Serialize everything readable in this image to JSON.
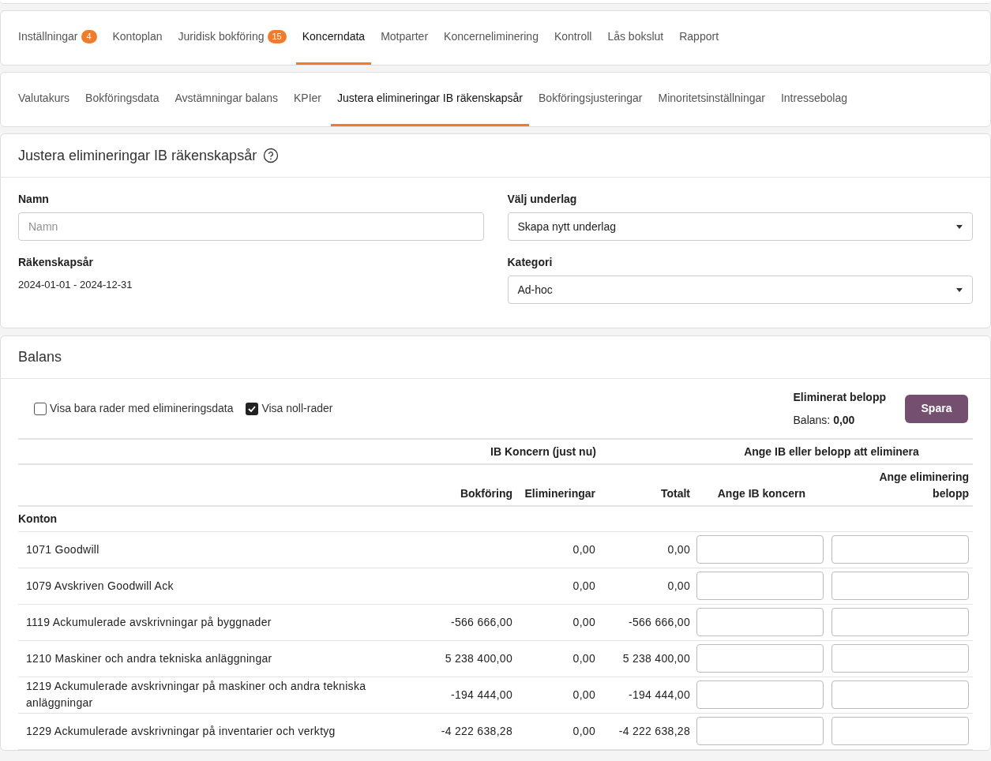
{
  "main_tabs": [
    {
      "label": "Inställningar",
      "badge": "4",
      "selected": false
    },
    {
      "label": "Kontoplan",
      "selected": false
    },
    {
      "label": "Juridisk bokföring",
      "badge": "15",
      "selected": false
    },
    {
      "label": "Koncerndata",
      "selected": true
    },
    {
      "label": "Motparter",
      "selected": false
    },
    {
      "label": "Koncerneliminering",
      "selected": false
    },
    {
      "label": "Kontroll",
      "selected": false
    },
    {
      "label": "Lås bokslut",
      "selected": false
    },
    {
      "label": "Rapport",
      "selected": false
    }
  ],
  "sub_tabs": [
    {
      "label": "Valutakurs",
      "selected": false
    },
    {
      "label": "Bokföringsdata",
      "selected": false
    },
    {
      "label": "Avstämningar balans",
      "selected": false
    },
    {
      "label": "KPIer",
      "selected": false
    },
    {
      "label": "Justera elimineringar IB räkenskapsår",
      "selected": true
    },
    {
      "label": "Bokföringsjusteringar",
      "selected": false
    },
    {
      "label": "Minoritetsinställningar",
      "selected": false
    },
    {
      "label": "Intressebolag",
      "selected": false
    }
  ],
  "form": {
    "title": "Justera elimineringar IB räkenskapsår",
    "name_label": "Namn",
    "name_placeholder": "Namn",
    "year_label": "Räkenskapsår",
    "year_value": "2024-01-01 - 2024-12-31",
    "basis_label": "Välj underlag",
    "basis_value": "Skapa nytt underlag",
    "category_label": "Kategori",
    "category_value": "Ad-hoc"
  },
  "balance": {
    "title": "Balans",
    "filters": [
      {
        "label": "Visa bara rader med elimineringsdata",
        "checked": false
      },
      {
        "label": "Visa noll-rader",
        "checked": true
      }
    ],
    "eliminated_label": "Eliminerat belopp",
    "balance_label": "Balans:",
    "balance_value": "0,00",
    "save_button": "Spara",
    "group_headers": [
      "IB Koncern (just nu)",
      "Ange IB eller belopp att eliminera"
    ],
    "columns": [
      "Bokföring",
      "Elimineringar",
      "Totalt",
      "Ange IB koncern",
      "Ange eliminering belopp"
    ],
    "section": "Konton",
    "rows": [
      {
        "account": "1071 Goodwill",
        "bokforing": "",
        "elim": "0,00",
        "total": "0,00"
      },
      {
        "account": "1079 Avskriven Goodwill Ack",
        "bokforing": "",
        "elim": "0,00",
        "total": "0,00"
      },
      {
        "account": "1119 Ackumulerade avskrivningar på byggnader",
        "bokforing": "-566 666,00",
        "elim": "0,00",
        "total": "-566 666,00"
      },
      {
        "account": "1210 Maskiner och andra tekniska anläggningar",
        "bokforing": "5 238 400,00",
        "elim": "0,00",
        "total": "5 238 400,00"
      },
      {
        "account": "1219 Ackumulerade avskrivningar på maskiner och andra tekniska anläggningar",
        "bokforing": "-194 444,00",
        "elim": "0,00",
        "total": "-194 444,00"
      },
      {
        "account": "1229 Ackumulerade avskrivningar på inventarier och verktyg",
        "bokforing": "-4 222 638,28",
        "elim": "0,00",
        "total": "-4 222 638,28"
      }
    ]
  }
}
